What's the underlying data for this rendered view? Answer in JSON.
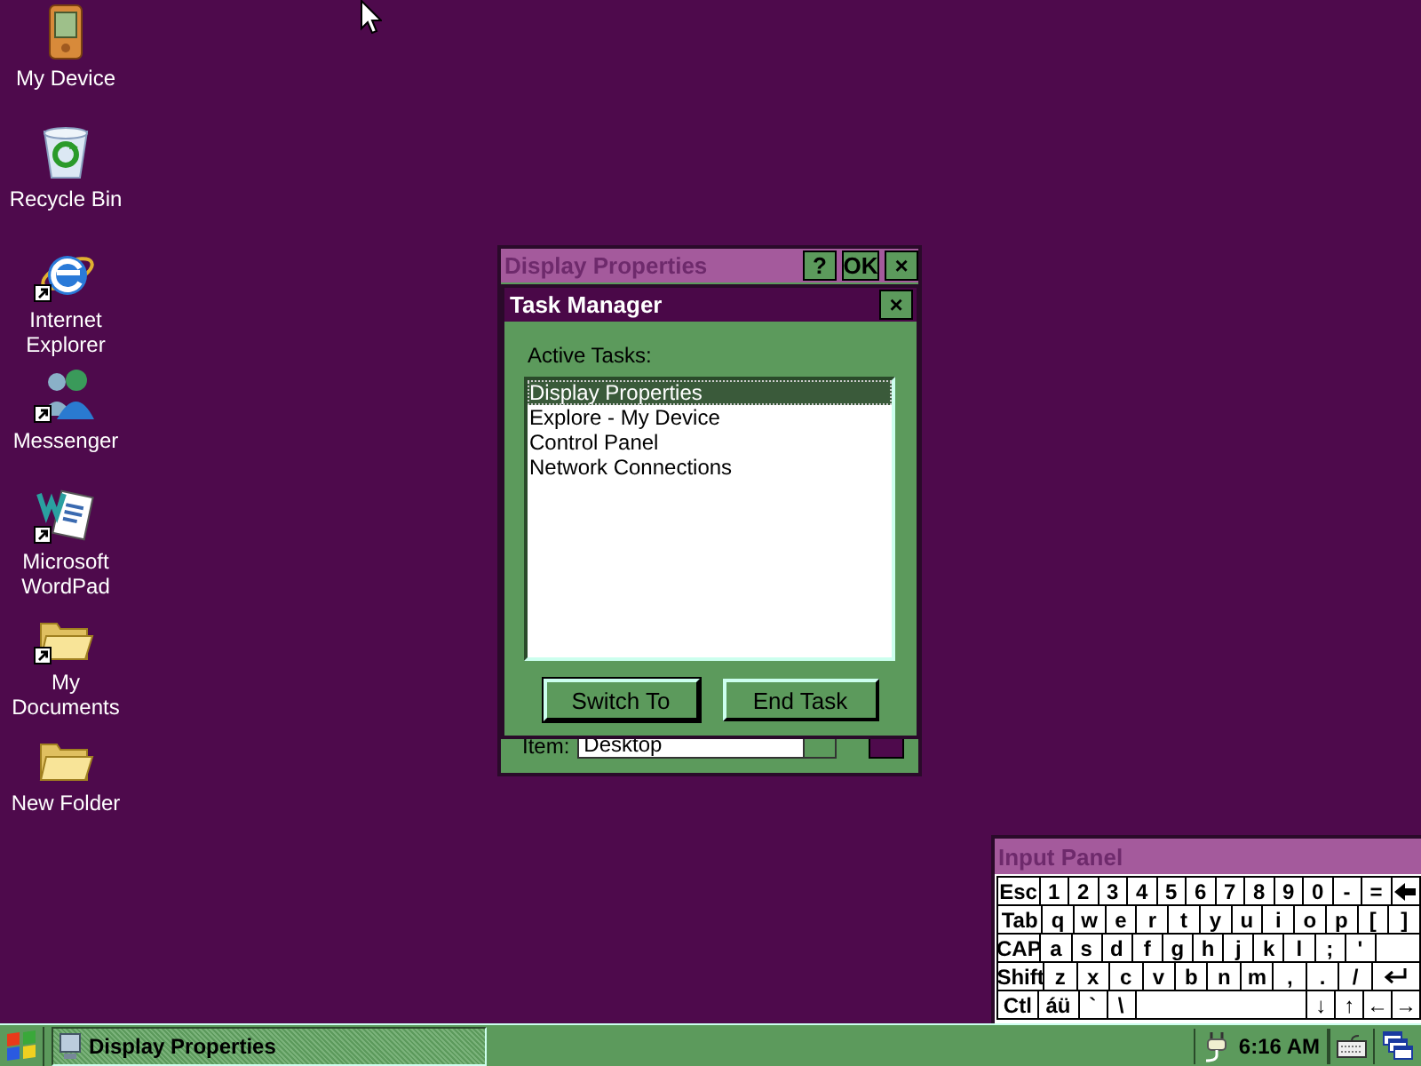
{
  "desktop_icons": [
    {
      "label": "My Device",
      "kind": "device",
      "shortcut": false
    },
    {
      "label": "Recycle Bin",
      "kind": "recycle",
      "shortcut": false
    },
    {
      "label": "Internet Explorer",
      "kind": "browser",
      "shortcut": true
    },
    {
      "label": "Messenger",
      "kind": "people",
      "shortcut": true
    },
    {
      "label": "Microsoft WordPad",
      "kind": "document",
      "shortcut": true
    },
    {
      "label": "My Documents",
      "kind": "folder",
      "shortcut": true
    },
    {
      "label": "New Folder",
      "kind": "folder",
      "shortcut": false
    }
  ],
  "display_properties": {
    "title": "Display Properties",
    "active": false,
    "title_buttons": [
      "?",
      "OK",
      "×"
    ],
    "item_label": "Item:",
    "item_value": "Desktop"
  },
  "task_manager": {
    "title": "Task Manager",
    "active": true,
    "close": "×",
    "list_label": "Active Tasks:",
    "tasks": [
      {
        "name": "Display Properties",
        "selected": true
      },
      {
        "name": "Explore - My Device",
        "selected": false
      },
      {
        "name": "Control Panel",
        "selected": false
      },
      {
        "name": "Network Connections",
        "selected": false
      }
    ],
    "buttons": [
      {
        "label": "Switch To",
        "default": true
      },
      {
        "label": "End Task",
        "default": false
      }
    ]
  },
  "input_panel": {
    "title": "Input Panel",
    "active": false,
    "rows": [
      {
        "keys": [
          {
            "label": "Esc",
            "kind": "wide"
          },
          {
            "label": "1",
            "kind": "key"
          },
          {
            "label": "2",
            "kind": "key"
          },
          {
            "label": "3",
            "kind": "key"
          },
          {
            "label": "4",
            "kind": "key"
          },
          {
            "label": "5",
            "kind": "key"
          },
          {
            "label": "6",
            "kind": "key"
          },
          {
            "label": "7",
            "kind": "key"
          },
          {
            "label": "8",
            "kind": "key"
          },
          {
            "label": "9",
            "kind": "key"
          },
          {
            "label": "0",
            "kind": "key"
          },
          {
            "label": "-",
            "kind": "key"
          },
          {
            "label": "=",
            "kind": "key"
          },
          {
            "kind": "backspace"
          }
        ]
      },
      {
        "keys": [
          {
            "label": "Tab",
            "kind": "wide"
          },
          {
            "label": "q",
            "kind": "key"
          },
          {
            "label": "w",
            "kind": "key"
          },
          {
            "label": "e",
            "kind": "key"
          },
          {
            "label": "r",
            "kind": "key"
          },
          {
            "label": "t",
            "kind": "key"
          },
          {
            "label": "y",
            "kind": "key"
          },
          {
            "label": "u",
            "kind": "key"
          },
          {
            "label": "i",
            "kind": "key"
          },
          {
            "label": "o",
            "kind": "key"
          },
          {
            "label": "p",
            "kind": "key"
          },
          {
            "label": "[",
            "kind": "key"
          },
          {
            "label": "]",
            "kind": "key"
          }
        ]
      },
      {
        "keys": [
          {
            "label": "CAP",
            "kind": "wide"
          },
          {
            "label": "a",
            "kind": "key"
          },
          {
            "label": "s",
            "kind": "key"
          },
          {
            "label": "d",
            "kind": "key"
          },
          {
            "label": "f",
            "kind": "key"
          },
          {
            "label": "g",
            "kind": "key"
          },
          {
            "label": "h",
            "kind": "key"
          },
          {
            "label": "j",
            "kind": "key"
          },
          {
            "label": "k",
            "kind": "key"
          },
          {
            "label": "l",
            "kind": "key"
          },
          {
            "label": ";",
            "kind": "key"
          },
          {
            "label": "'",
            "kind": "key"
          },
          {
            "kind": "blank"
          }
        ]
      },
      {
        "keys": [
          {
            "label": "Shift",
            "kind": "wide"
          },
          {
            "label": "z",
            "kind": "key"
          },
          {
            "label": "x",
            "kind": "key"
          },
          {
            "label": "c",
            "kind": "key"
          },
          {
            "label": "v",
            "kind": "key"
          },
          {
            "label": "b",
            "kind": "key"
          },
          {
            "label": "n",
            "kind": "key"
          },
          {
            "label": "m",
            "kind": "key"
          },
          {
            "label": ",",
            "kind": "key"
          },
          {
            "label": ".",
            "kind": "key"
          },
          {
            "label": "/",
            "kind": "key"
          },
          {
            "kind": "enter"
          }
        ]
      },
      {
        "keys": [
          {
            "label": "Ctl",
            "kind": "wide"
          },
          {
            "label": "áü",
            "kind": "wide"
          },
          {
            "label": "`",
            "kind": "key"
          },
          {
            "label": "\\",
            "kind": "key"
          },
          {
            "kind": "space"
          },
          {
            "label": "↓",
            "kind": "key"
          },
          {
            "label": "↑",
            "kind": "key"
          },
          {
            "label": "←",
            "kind": "key"
          },
          {
            "label": "→",
            "kind": "key"
          }
        ]
      }
    ]
  },
  "taskbar": {
    "tasks": [
      {
        "label": "Display Properties"
      }
    ],
    "clock": "6:16 AM"
  }
}
